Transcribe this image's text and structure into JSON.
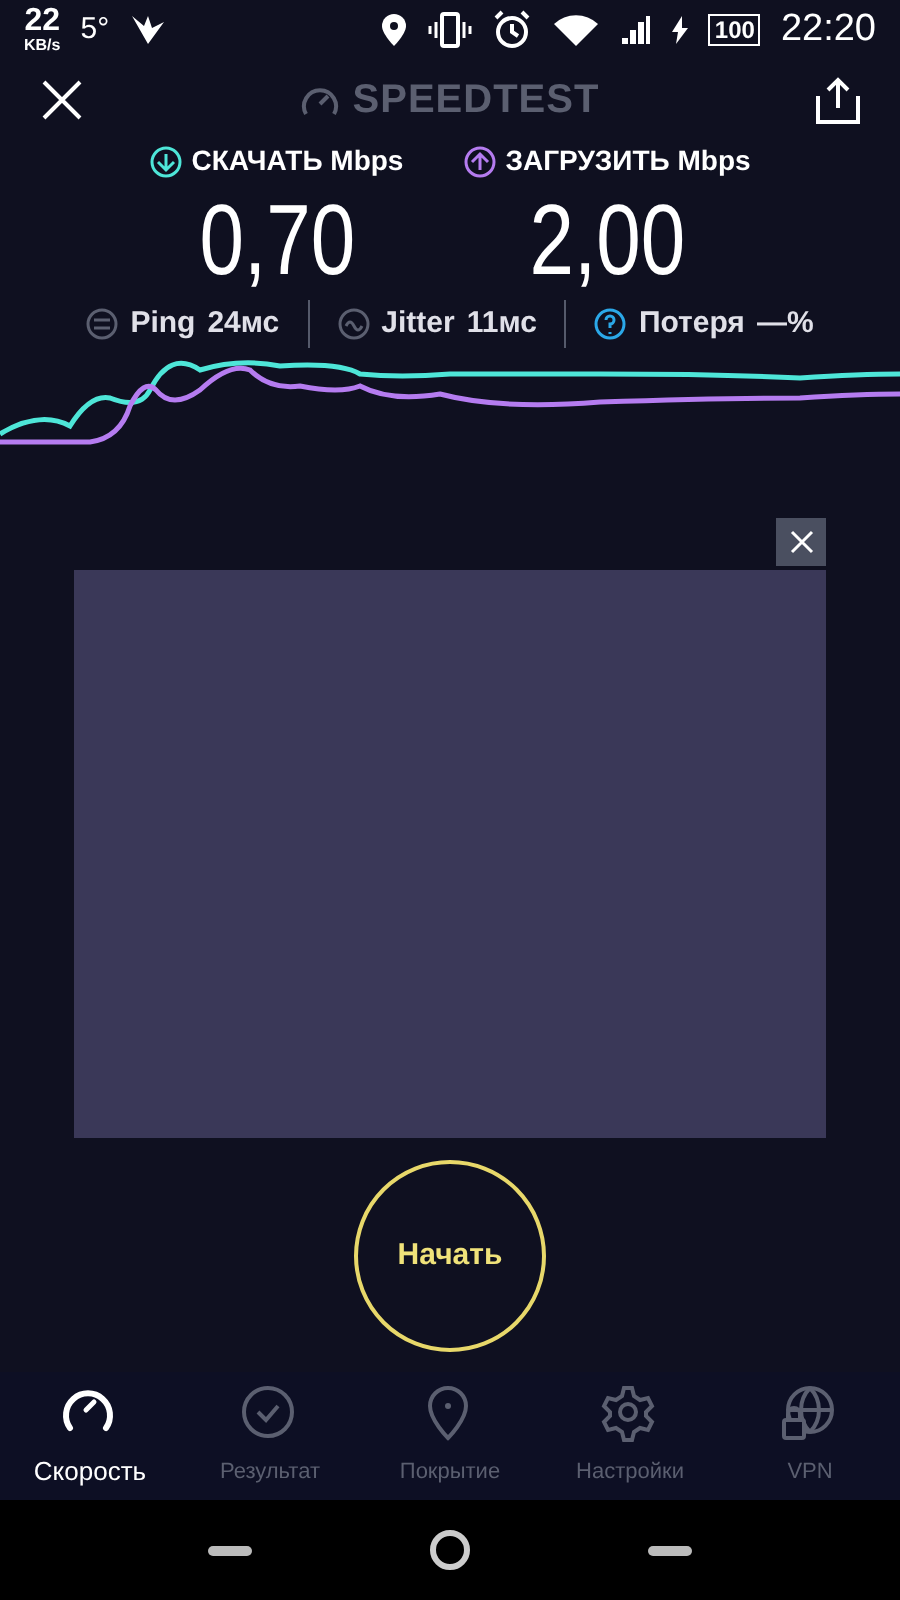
{
  "status_bar": {
    "net_speed": "22",
    "net_unit": "KB/s",
    "temperature": "5°",
    "battery": "100",
    "time": "22:20"
  },
  "header": {
    "title": "SPEEDTEST"
  },
  "speeds": [
    {
      "kind": "download",
      "label": "СКАЧАТЬ Mbps",
      "value": "0,70"
    },
    {
      "kind": "upload",
      "label": "ЗАГРУЗИТЬ Mbps",
      "value": "2,00"
    }
  ],
  "metrics": [
    {
      "kind": "ping",
      "label": "Ping",
      "value": "24мс"
    },
    {
      "kind": "jitter",
      "label": "Jitter",
      "value": "11мс"
    },
    {
      "kind": "loss",
      "label": "Потеря",
      "value": "—%"
    }
  ],
  "start_button": "Начать",
  "nav": [
    {
      "kind": "speed",
      "label": "Скорость",
      "selected": true
    },
    {
      "kind": "result",
      "label": "Результат",
      "selected": false
    },
    {
      "kind": "coverage",
      "label": "Покрытие",
      "selected": false
    },
    {
      "kind": "settings",
      "label": "Настройки",
      "selected": false
    },
    {
      "kind": "vpn",
      "label": "VPN",
      "selected": false
    }
  ]
}
